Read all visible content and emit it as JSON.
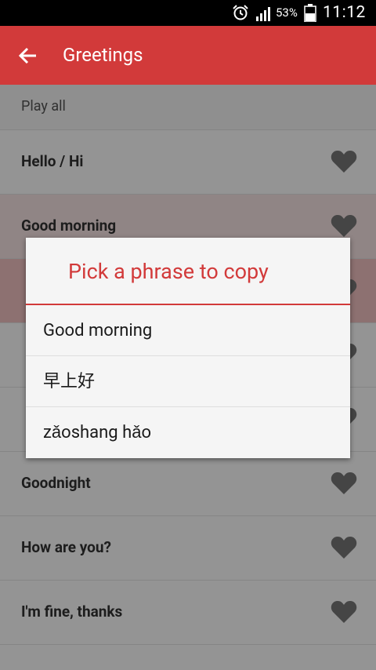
{
  "status_bar": {
    "battery_percent": "53%",
    "time": "11:12"
  },
  "app_bar": {
    "title": "Greetings"
  },
  "play_all": {
    "label": "Play all"
  },
  "list": {
    "items": [
      {
        "label": "Hello / Hi"
      },
      {
        "label": "Good morning"
      },
      {
        "label": ""
      },
      {
        "label": ""
      },
      {
        "label": ""
      },
      {
        "label": "Goodnight"
      },
      {
        "label": "How are you?"
      },
      {
        "label": "I'm fine, thanks"
      }
    ]
  },
  "dialog": {
    "title": "Pick a phrase to copy",
    "options": [
      {
        "label": "Good morning"
      },
      {
        "label": "早上好"
      },
      {
        "label": "zǎoshang hǎo"
      }
    ]
  },
  "colors": {
    "accent": "#d23a3a",
    "status_bar": "#000000"
  }
}
